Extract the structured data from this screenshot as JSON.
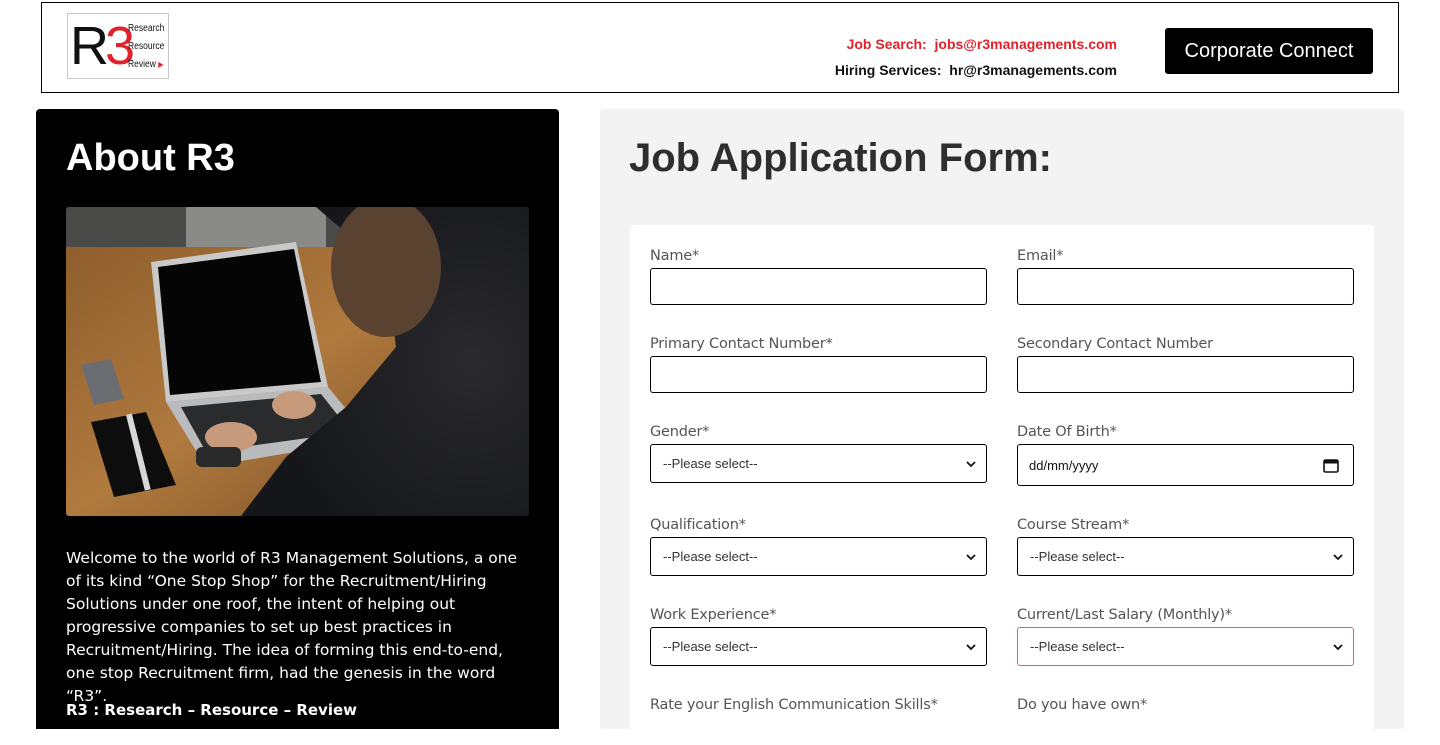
{
  "header": {
    "logo": {
      "mark": "R3",
      "line1": "Research",
      "line2": "Resource",
      "line3": "Review"
    },
    "job_search_label": "Job Search:",
    "job_search_email": "jobs@r3managements.com",
    "hiring_label": "Hiring Services:",
    "hiring_email": "hr@r3managements.com",
    "corporate_button": "Corporate Connect"
  },
  "about": {
    "title": "About R3",
    "description": "Welcome to the world of R3 Management Solutions, a one of its kind “One Stop Shop” for the Recruitment/Hiring Solutions under one roof, the intent of helping out progressive companies to set up best practices in Recruitment/Hiring. The idea of forming this end-to-end, one stop Recruitment firm, had the genesis in the word “R3”.",
    "tagline": "R3 : Research – Resource – Review"
  },
  "form": {
    "title": "Job Application Form:",
    "name_label": "Name*",
    "email_label": "Email*",
    "primary_label": "Primary Contact Number*",
    "secondary_label": "Secondary Contact Number",
    "gender_label": "Gender*",
    "gender_value": "--Please select--",
    "dob_label": "Date Of Birth*",
    "dob_placeholder": "dd/mm/yyyy",
    "qualification_label": "Qualification*",
    "qualification_value": "--Please select--",
    "course_label": "Course Stream*",
    "course_value": "--Please select--",
    "experience_label": "Work Experience*",
    "experience_value": "--Please select--",
    "salary_label": "Current/Last Salary (Monthly)*",
    "salary_value": "--Please select--",
    "english_label": "Rate your English Communication Skills*",
    "own_label": "Do you have own*"
  },
  "colors": {
    "accent_red": "#e2222a",
    "panel_black": "#000000",
    "form_bg": "#f3f3f3",
    "error_border": "#e26060"
  }
}
